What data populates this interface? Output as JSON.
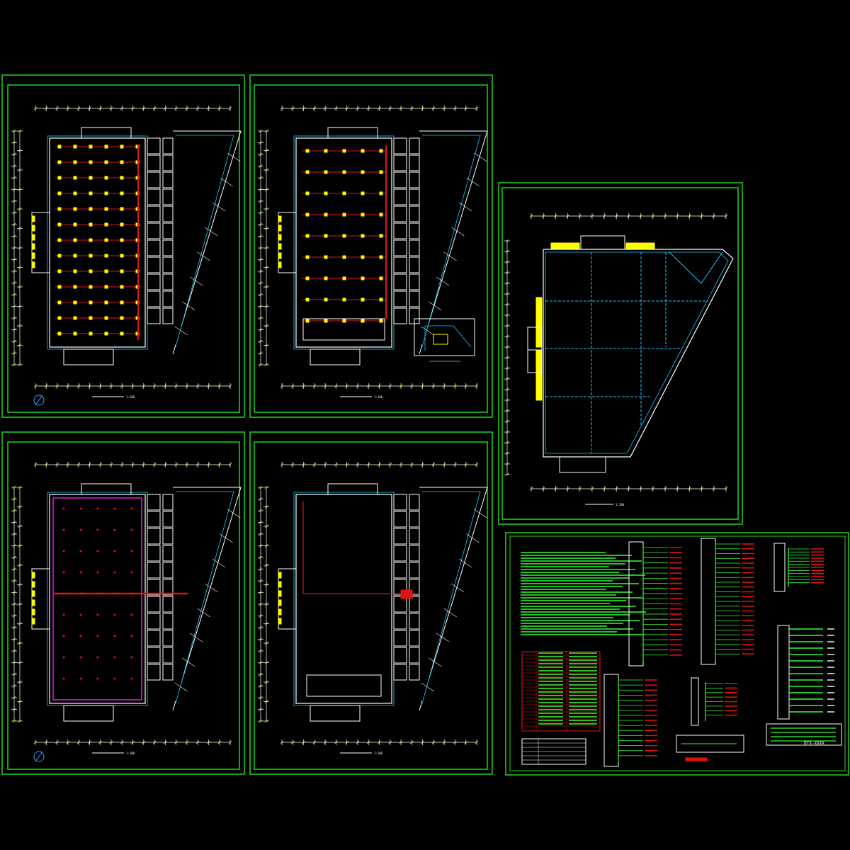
{
  "app": {
    "background": "#000000"
  },
  "colors": {
    "frame": "#1fd41f",
    "wall": "#ffffff",
    "circuit": "#e01414",
    "conduit": "#19c8ff",
    "accent": "#ffff00",
    "magenta": "#e020e0",
    "grid_blue": "#3aa0ff",
    "note_green": "#33ff33"
  },
  "sheets": {
    "floor1_lighting": {
      "scale_note": "1:100"
    },
    "floor2_lighting": {
      "scale_note": "1:100"
    },
    "roof_plan": {
      "scale_note": "1:100"
    },
    "floor1_power": {
      "scale_note": "1:100"
    },
    "floor2_power": {
      "scale_note": "1:100"
    }
  },
  "system_sheet": {
    "legend_code": "DTX-XXXX"
  },
  "icons": {
    "north_arrow": "north-arrow-icon",
    "distribution_box": "distribution-box-icon",
    "light_fixture": "light-fixture-icon"
  }
}
